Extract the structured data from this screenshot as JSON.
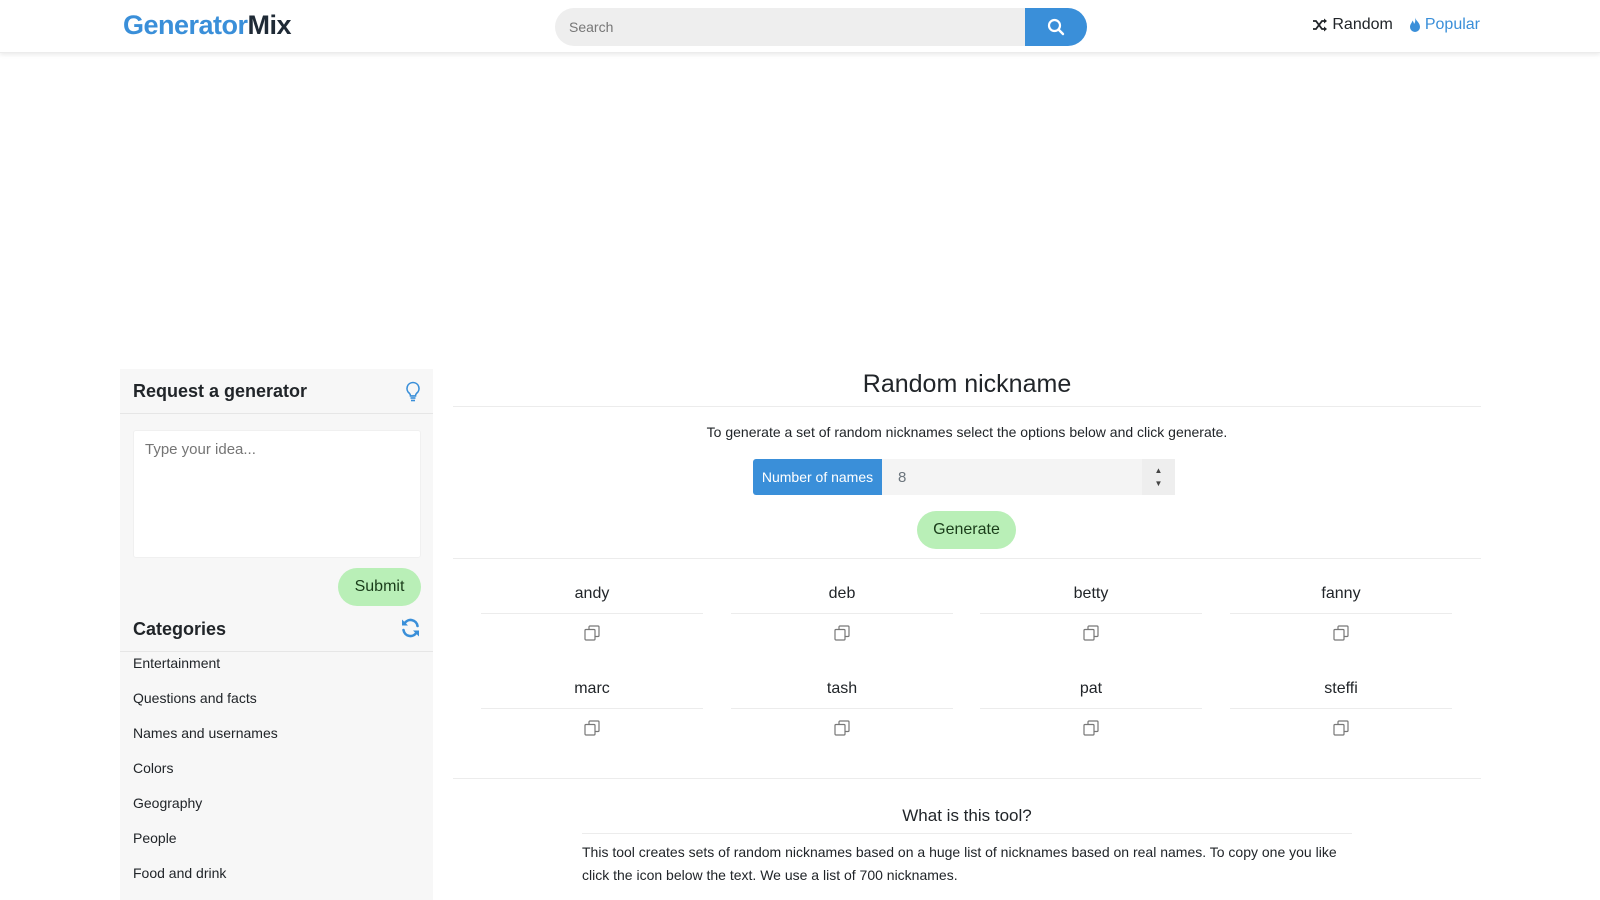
{
  "header": {
    "logo_part1": "Generator",
    "logo_part2": "Mix",
    "search_placeholder": "Search",
    "nav_random": "Random",
    "nav_popular": "Popular"
  },
  "sidebar": {
    "request_title": "Request a generator",
    "idea_placeholder": "Type your idea...",
    "submit_label": "Submit",
    "categories_title": "Categories",
    "categories": [
      "Entertainment",
      "Questions and facts",
      "Names and usernames",
      "Colors",
      "Geography",
      "People",
      "Food and drink"
    ]
  },
  "main": {
    "title": "Random nickname",
    "description": "To generate a set of random nicknames select the options below and click generate.",
    "number_label": "Number of names",
    "number_value": "8",
    "generate_label": "Generate",
    "names": [
      "andy",
      "deb",
      "betty",
      "fanny",
      "marc",
      "tash",
      "pat",
      "steffi"
    ],
    "tool_title": "What is this tool?",
    "tool_text": "This tool creates sets of random nicknames based on a huge list of nicknames based on real names. To copy one you like click the icon below the text. We use a list of 700 nicknames."
  },
  "colors": {
    "accent": "#3a8fd9",
    "button_green": "#b9efb7"
  }
}
